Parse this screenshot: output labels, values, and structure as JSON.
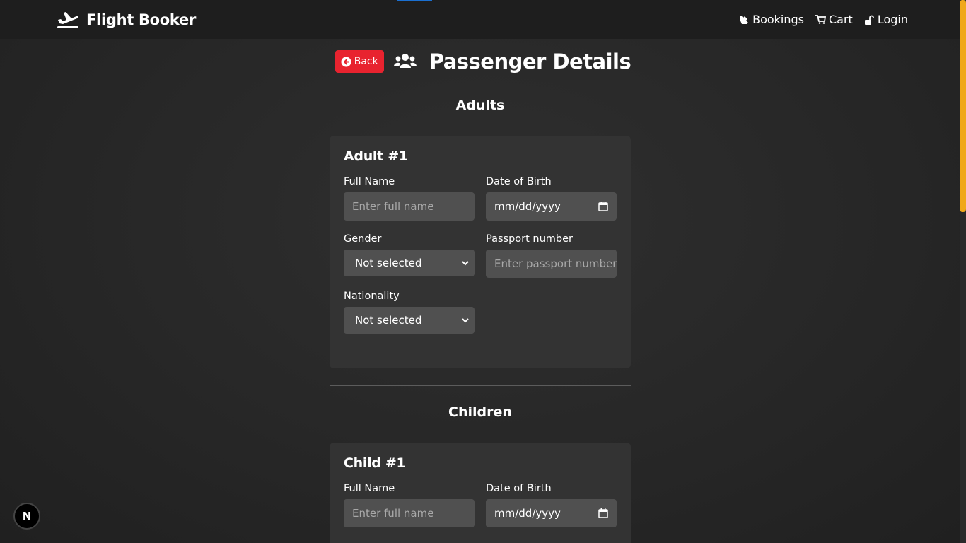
{
  "navbar": {
    "brand": "Flight Booker",
    "links": [
      {
        "label": "Bookings",
        "icon": "ticket-icon"
      },
      {
        "label": "Cart",
        "icon": "cart-icon"
      },
      {
        "label": "Login",
        "icon": "unlock-icon"
      }
    ]
  },
  "header": {
    "back_label": "Back",
    "title": "Passenger Details"
  },
  "sections": {
    "adults_title": "Adults",
    "children_title": "Children"
  },
  "adult_card": {
    "title": "Adult #1",
    "full_name_label": "Full Name",
    "full_name_placeholder": "Enter full name",
    "dob_label": "Date of Birth",
    "dob_value": "mm/dd/yyyy",
    "gender_label": "Gender",
    "gender_value": "Not selected",
    "passport_label": "Passport number",
    "passport_placeholder": "Enter passport number",
    "nationality_label": "Nationality",
    "nationality_value": "Not selected"
  },
  "child_card": {
    "title": "Child #1",
    "full_name_label": "Full Name",
    "full_name_placeholder": "Enter full name",
    "dob_label": "Date of Birth",
    "dob_value": "mm/dd/yyyy"
  },
  "dev_badge": "N",
  "colors": {
    "back_button": "#e8232f",
    "scrollbar": "#f0a81a",
    "card": "#333333",
    "input": "#505050"
  }
}
